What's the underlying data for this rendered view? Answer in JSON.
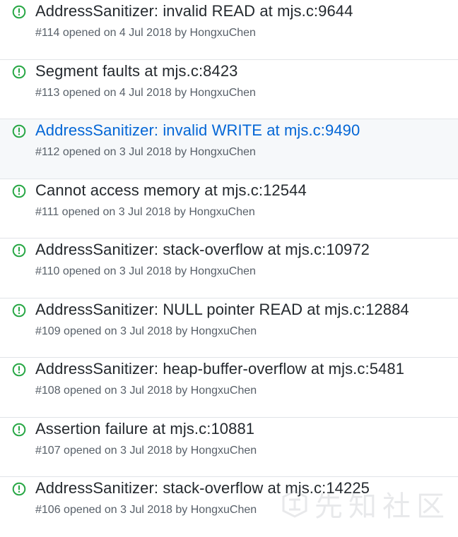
{
  "colors": {
    "open_icon": "#28a745",
    "title": "#24292e",
    "title_hover": "#0366d6",
    "meta": "#586069",
    "row_hover_bg": "#f6f8fa",
    "divider": "#e1e4e8"
  },
  "issues": [
    {
      "title": "AddressSanitizer: invalid READ at mjs.c:9644",
      "meta": "#114 opened on 4 Jul 2018 by HongxuChen",
      "status_icon": "issue-opened-icon"
    },
    {
      "title": "Segment faults at mjs.c:8423",
      "meta": "#113 opened on 4 Jul 2018 by HongxuChen",
      "status_icon": "issue-opened-icon"
    },
    {
      "title": "AddressSanitizer: invalid WRITE at mjs.c:9490",
      "meta": "#112 opened on 3 Jul 2018 by HongxuChen",
      "status_icon": "issue-opened-icon",
      "hovered": true
    },
    {
      "title": "Cannot access memory at mjs.c:12544",
      "meta": "#111 opened on 3 Jul 2018 by HongxuChen",
      "status_icon": "issue-opened-icon"
    },
    {
      "title": "AddressSanitizer: stack-overflow at mjs.c:10972",
      "meta": "#110 opened on 3 Jul 2018 by HongxuChen",
      "status_icon": "issue-opened-icon"
    },
    {
      "title": "AddressSanitizer: NULL pointer READ at mjs.c:12884",
      "meta": "#109 opened on 3 Jul 2018 by HongxuChen",
      "status_icon": "issue-opened-icon"
    },
    {
      "title": "AddressSanitizer: heap-buffer-overflow at mjs.c:5481",
      "meta": "#108 opened on 3 Jul 2018 by HongxuChen",
      "status_icon": "issue-opened-icon"
    },
    {
      "title": "Assertion failure at mjs.c:10881",
      "meta": "#107 opened on 3 Jul 2018 by HongxuChen",
      "status_icon": "issue-opened-icon"
    },
    {
      "title": "AddressSanitizer: stack-overflow at mjs.c:14225",
      "meta": "#106 opened on 3 Jul 2018 by HongxuChen",
      "status_icon": "issue-opened-icon"
    }
  ],
  "watermark": {
    "text": "先知社区",
    "icon": "xianzhi-logo-icon"
  }
}
